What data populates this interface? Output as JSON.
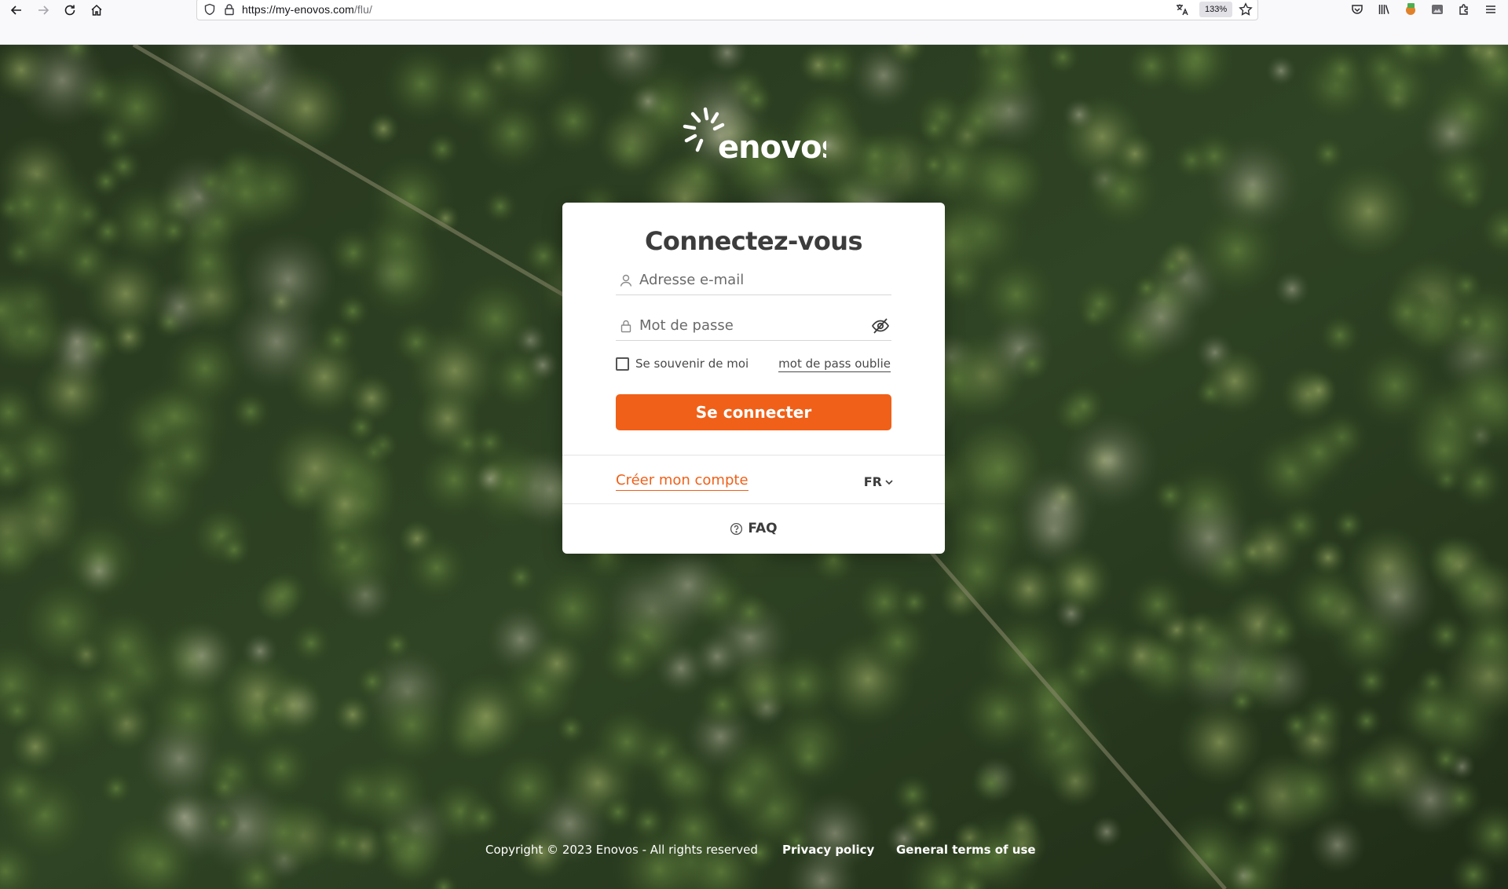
{
  "browser": {
    "url_host": "https://my-enovos.com",
    "url_path": "/flu/",
    "zoom": "133%"
  },
  "brand": {
    "name": "enovos",
    "accent_color": "#f06018"
  },
  "login": {
    "title": "Connectez-vous",
    "email_placeholder": "Adresse e-mail",
    "password_placeholder": "Mot de passe",
    "remember_label": "Se souvenir de moi",
    "remember_checked": false,
    "forgot_link": "mot de pass oublie",
    "submit_label": "Se connecter",
    "create_account": "Créer mon compte",
    "language": "FR",
    "faq": "FAQ"
  },
  "footer": {
    "copyright": "Copyright © 2023 Enovos - All rights reserved",
    "privacy": "Privacy policy",
    "terms": "General terms of use"
  },
  "icons": {
    "email_field": "user-icon",
    "password_field": "lock-icon",
    "password_toggle": "eye-off-icon",
    "faq": "question-circle-icon"
  }
}
